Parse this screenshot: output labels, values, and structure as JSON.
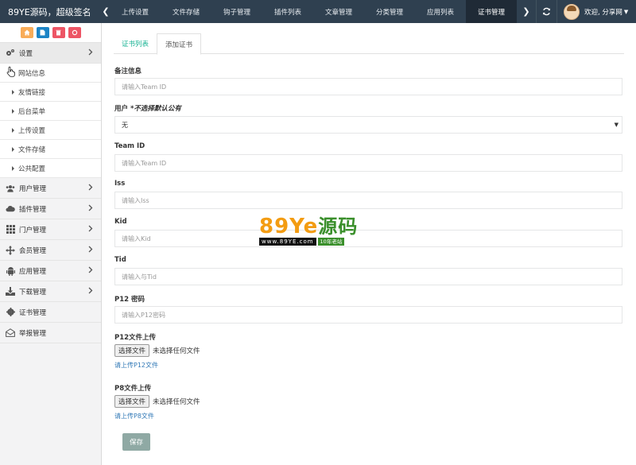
{
  "brand": {
    "title": "89YE源码，超级签名"
  },
  "topnav": {
    "tabs": [
      {
        "label": "上传设置",
        "active": false
      },
      {
        "label": "文件存储",
        "active": false
      },
      {
        "label": "钩子管理",
        "active": false
      },
      {
        "label": "插件列表",
        "active": false
      },
      {
        "label": "文章管理",
        "active": false
      },
      {
        "label": "分类管理",
        "active": false
      },
      {
        "label": "应用列表",
        "active": false
      },
      {
        "label": "证书管理",
        "active": true
      }
    ],
    "user_label": "欢迎, 分享网"
  },
  "sidebar": {
    "settings_label": "设置",
    "current_item": "网站信息",
    "sub_items": [
      "友情链接",
      "后台菜单",
      "上传设置",
      "文件存储",
      "公共配置"
    ],
    "menus": [
      {
        "label": "用户管理",
        "icon": "users-icon",
        "has_children": true
      },
      {
        "label": "插件管理",
        "icon": "cloud-icon",
        "has_children": true
      },
      {
        "label": "门户管理",
        "icon": "grid-icon",
        "has_children": true
      },
      {
        "label": "会员管理",
        "icon": "move-arrows-icon",
        "has_children": true
      },
      {
        "label": "应用管理",
        "icon": "android-icon",
        "has_children": true
      },
      {
        "label": "下载管理",
        "icon": "download-icon",
        "has_children": true
      },
      {
        "label": "证书管理",
        "icon": "gear-badge-icon",
        "has_children": false
      },
      {
        "label": "举报管理",
        "icon": "envelope-open-icon",
        "has_children": false
      }
    ]
  },
  "tabs": {
    "list": "证书列表",
    "add": "添加证书"
  },
  "form": {
    "remark": {
      "label": "备注信息",
      "placeholder": "请输入Team ID"
    },
    "user": {
      "label": "用户",
      "hint": "*不选择默认公有",
      "value": "无"
    },
    "team_id": {
      "label": "Team ID",
      "placeholder": "请输入Team ID"
    },
    "iss": {
      "label": "Iss",
      "placeholder": "请输入Iss"
    },
    "kid": {
      "label": "Kid",
      "placeholder": "请输入Kid"
    },
    "tid": {
      "label": "Tid",
      "placeholder": "请输入与Tid"
    },
    "p12_password": {
      "label": "P12 密码",
      "placeholder": "请输入P12密码"
    },
    "p12_file": {
      "label": "P12文件上传",
      "button": "选择文件",
      "status": "未选择任何文件",
      "help": "请上传P12文件"
    },
    "p8_file": {
      "label": "P8文件上传",
      "button": "选择文件",
      "status": "未选择任何文件",
      "help": "请上传P8文件"
    },
    "save": "保存"
  },
  "watermark": {
    "main": "89Ye",
    "cn": "源码",
    "url": "www.89YE.com",
    "tag": "10年老站"
  },
  "colors": {
    "topbar": "#2f4050",
    "accent": "#1ab394",
    "save_button": "#8fa9a4"
  }
}
